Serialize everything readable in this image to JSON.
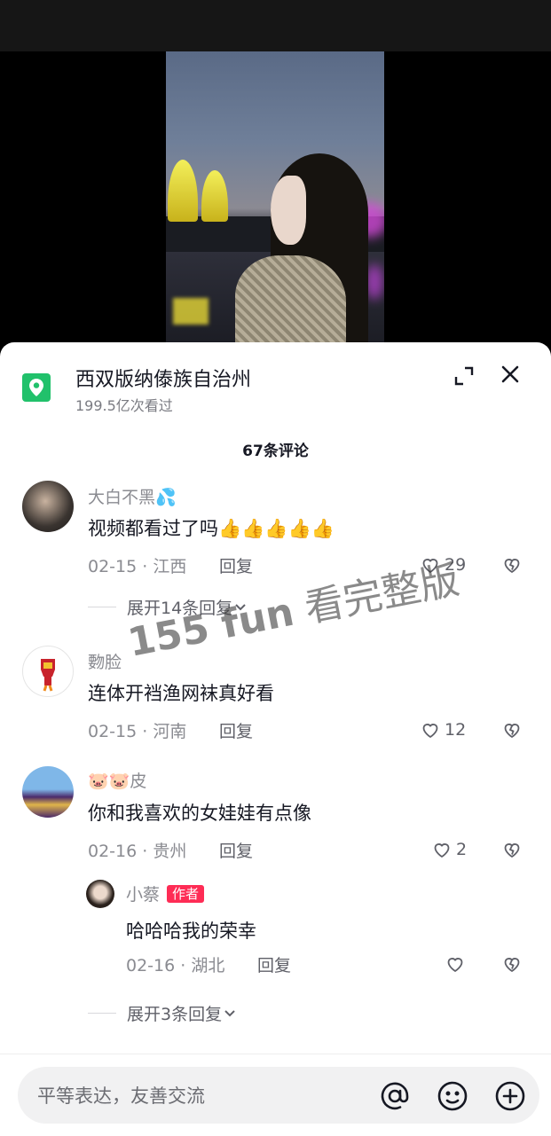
{
  "location": {
    "title": "西双版纳傣族自治州",
    "subtitle": "199.5亿次看过"
  },
  "comments_count": "67条评论",
  "comments": [
    {
      "author": "大白不黑💦",
      "text": "视频都看过了吗👍👍👍👍👍",
      "date_location": "02-15 · 江西",
      "reply_label": "回复",
      "likes": "29",
      "expand_label": "展开14条回复"
    },
    {
      "author": "覅脸",
      "text": "连体开裆渔网袜真好看",
      "date_location": "02-15 · 河南",
      "reply_label": "回复",
      "likes": "12"
    },
    {
      "author": "🐷🐷皮",
      "text": "你和我喜欢的女娃娃有点像",
      "date_location": "02-16 · 贵州",
      "reply_label": "回复",
      "likes": "2"
    }
  ],
  "reply": {
    "author": "小蔡",
    "badge": "作者",
    "text": "哈哈哈我的荣幸",
    "date_location": "02-16 · 湖北",
    "reply_label": "回复",
    "expand_label": "展开3条回复"
  },
  "watermark": {
    "site": "155 fun",
    "text": "看完整版"
  },
  "input": {
    "placeholder": "平等表达，友善交流"
  },
  "colors": {
    "accent": "#fe2c55",
    "location_icon": "#21c16b",
    "sheet_bg": "#ffffff"
  },
  "icons": [
    "location-pin-icon",
    "expand-icon",
    "close-icon",
    "heart-icon",
    "broken-heart-icon",
    "chevron-down-icon",
    "at-icon",
    "emoji-icon",
    "plus-icon"
  ]
}
